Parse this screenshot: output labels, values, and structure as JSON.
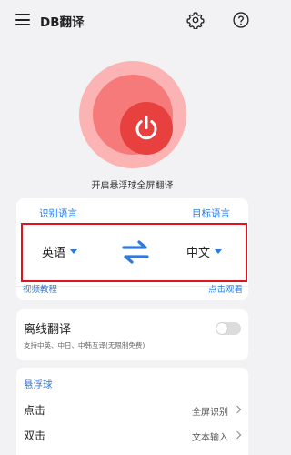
{
  "app": {
    "title": "DB翻译"
  },
  "header": {
    "menu_icon": "menu-icon",
    "settings_icon": "gear-icon",
    "help_icon": "help-icon"
  },
  "colors": {
    "accent": "#2a7ae2",
    "power_outer": "#fcb3b3",
    "power_mid": "#f77a7a",
    "power_inner": "#e83f3f",
    "highlight_border": "#e0141c"
  },
  "power": {
    "icon": "power-icon",
    "label": "开启悬浮球全屏翻译"
  },
  "languages": {
    "source_header": "识别语言",
    "target_header": "目标语言",
    "source": "英语",
    "target": "中文",
    "swap_icon": "swap-arrows-icon"
  },
  "tutorial": {
    "label": "视频教程",
    "action": "点击观看"
  },
  "offline": {
    "title": "离线翻译",
    "subtitle": "支持中英、中日、中韩互译(无限制免费)",
    "enabled": false
  },
  "floating_ball": {
    "header": "悬浮球",
    "rows": [
      {
        "action": "点击",
        "value": "全屏识别"
      },
      {
        "action": "双击",
        "value": "文本输入"
      }
    ]
  }
}
